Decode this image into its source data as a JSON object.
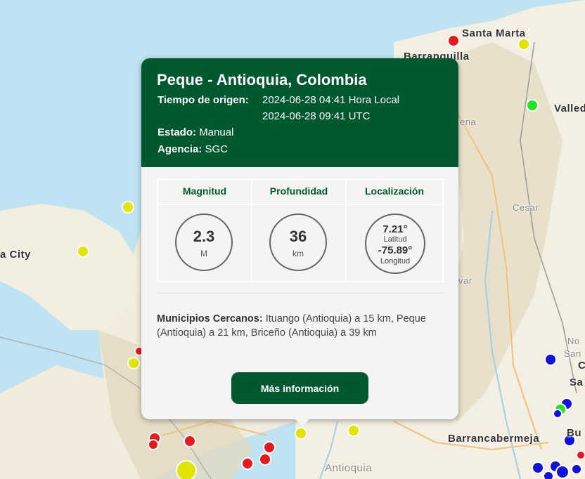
{
  "map": {
    "labels": {
      "santa_marta": "Santa Marta",
      "barranquilla": "Barranquilla",
      "valledupar": "Valled",
      "cesar": "Cesar",
      "panama_city": "a City",
      "barrancabermeja": "Barrancabermeja",
      "antioquia": "Antioquia",
      "sucre_partial": "var",
      "enamed": "ena",
      "n_partial": "No",
      "san_partial": "San",
      "c_partial": "C",
      "sa_partial": "Sa",
      "bu_partial": "Bu"
    },
    "marker_colors": {
      "red": "#e8191d",
      "yellow": "#e3e400",
      "green": "#1fe61f",
      "blue": "#1111dd"
    }
  },
  "popup": {
    "title": "Peque - Antioquia, Colombia",
    "origin_label": "Tiempo de origen:",
    "origin_local": "2024-06-28 04:41 Hora Local",
    "origin_utc": "2024-06-28 09:41 UTC",
    "status_label": "Estado:",
    "status_value": "Manual",
    "agency_label": "Agencia:",
    "agency_value": "SGC",
    "columns": {
      "magnitude": "Magnitud",
      "depth": "Profundidad",
      "location": "Localización"
    },
    "magnitude": {
      "value": "2.3",
      "unit": "M"
    },
    "depth": {
      "value": "36",
      "unit": "km"
    },
    "location": {
      "latitude": "7.21°",
      "latitude_label": "Latitud",
      "longitude": "-75.89°",
      "longitude_label": "Longitud"
    },
    "nearby_label": "Municipios Cercanos:",
    "nearby_text": "Ituango (Antioquia) a 15 km, Peque (Antioquia) a 21 km, Briceño (Antioquia) a 39 km",
    "more_button": "Más información"
  }
}
